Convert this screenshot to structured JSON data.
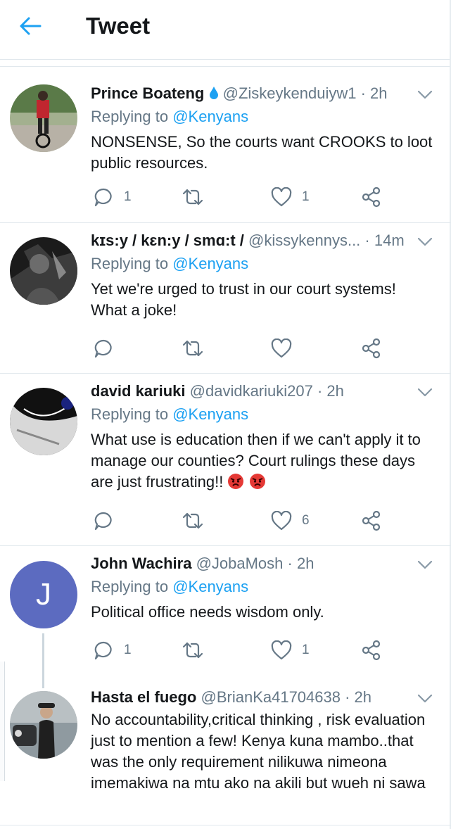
{
  "header": {
    "title": "Tweet",
    "back_icon": "back-arrow-icon",
    "accent": "#1da1f2"
  },
  "tweets": [
    {
      "name": "Prince Boateng",
      "badge_icon": "droplet-icon",
      "handle": "@Ziskeykenduiyw1",
      "time": "· 2h",
      "replying_prefix": "Replying to",
      "replying_to": "@Kenyans",
      "text": "NONSENSE, So the courts want CROOKS to loot public resources.",
      "reply_count": "1",
      "retweet_count": "",
      "like_count": "1"
    },
    {
      "name": "kɪs:y / kɛn:y / smɑ:t /",
      "handle": "@kissykennys...",
      "time": "· 14m",
      "replying_prefix": "Replying to",
      "replying_to": "@Kenyans",
      "text": "Yet we're urged to trust in our court systems! What a joke!",
      "reply_count": "",
      "retweet_count": "",
      "like_count": ""
    },
    {
      "name": "david kariuki",
      "handle": "@davidkariuki207",
      "time": "· 2h",
      "replying_prefix": "Replying to",
      "replying_to": "@Kenyans",
      "text": "What use is education then if we can't apply it to manage our counties? Court rulings these days are just frustrating!!",
      "emoji": "angry-face-emoji x2",
      "reply_count": "",
      "retweet_count": "",
      "like_count": "6"
    },
    {
      "name": "John Wachira",
      "handle": "@JobaMosh",
      "time": "· 2h",
      "avatar_letter": "J",
      "avatar_color": "#5c6bc0",
      "replying_prefix": "Replying to",
      "replying_to": "@Kenyans",
      "text": "Political office needs wisdom only.",
      "reply_count": "1",
      "retweet_count": "",
      "like_count": "1"
    },
    {
      "name": "Hasta el fuego",
      "handle": "@BrianKa41704638",
      "time": "· 2h",
      "text": "No accountability,critical thinking , risk evaluation just to mention a few! Kenya kuna mambo..that was the only requirement nilikuwa nimeona imemakiwa na mtu ako na akili but wueh ni sawa"
    }
  ]
}
